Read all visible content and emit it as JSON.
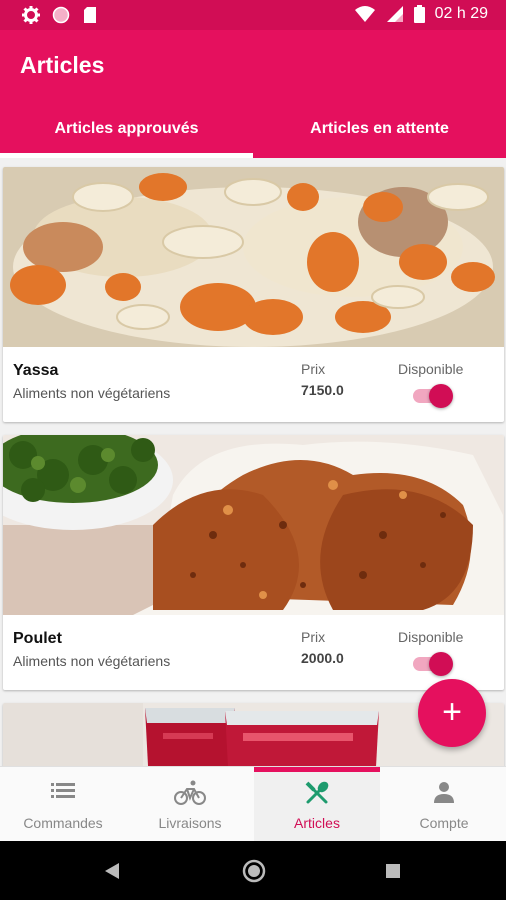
{
  "status_bar": {
    "time": "02 h 29",
    "icons": [
      "gear-icon",
      "circle-icon",
      "sd-card-icon",
      "wifi-icon",
      "signal-icon",
      "battery-icon"
    ]
  },
  "app_bar": {
    "title": "Articles"
  },
  "tabs": [
    {
      "label": "Articles approuvés",
      "selected": true
    },
    {
      "label": "Articles en attente",
      "selected": false
    }
  ],
  "items": [
    {
      "name": "Yassa",
      "category": "Aliments non végétariens",
      "price_label": "Prix",
      "price": "7150.0",
      "available_label": "Disponible",
      "available": true,
      "image": "yassa-photo"
    },
    {
      "name": "Poulet",
      "category": "Aliments non végétariens",
      "price_label": "Prix",
      "price": "2000.0",
      "available_label": "Disponible",
      "available": true,
      "image": "chicken-photo"
    },
    {
      "image": "drinks-photo"
    }
  ],
  "fab": {
    "label": "+"
  },
  "bottom_nav": [
    {
      "label": "Commandes",
      "icon": "list-icon"
    },
    {
      "label": "Livraisons",
      "icon": "bike-icon"
    },
    {
      "label": "Articles",
      "icon": "utensils-icon",
      "active": true
    },
    {
      "label": "Compte",
      "icon": "person-icon"
    }
  ],
  "colors": {
    "primary": "#e5105e",
    "primary_dark": "#d10d55",
    "toggle_track": "#f1a7c0"
  }
}
